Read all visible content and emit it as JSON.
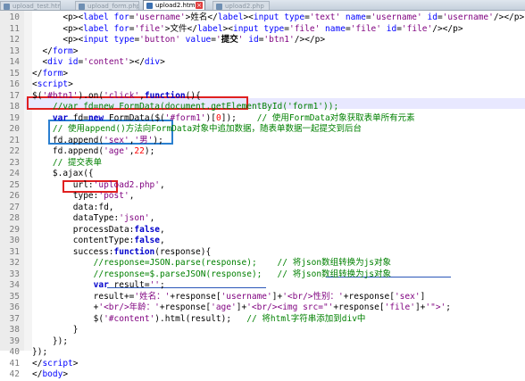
{
  "tabs": [
    {
      "label": "upload_test.html"
    },
    {
      "label": "upload_form.php"
    },
    {
      "label": "upload2.html"
    },
    {
      "label": "upload2.php"
    }
  ],
  "editor": {
    "lines": [
      {
        "no": "10",
        "html": "      &lt;p&gt;&lt;<span class='tag'>label</span> <span class='tag'>for</span>=<span class='str'>'username'</span>&gt;姓名&lt;/<span class='tag'>label</span>&gt;&lt;<span class='tag'>input</span> <span class='tag'>type</span>=<span class='str'>'text'</span> <span class='tag'>name</span>=<span class='str'>'username'</span> <span class='tag'>id</span>=<span class='str'>'username'</span>/&gt;&lt;/p&gt;"
      },
      {
        "no": "11",
        "html": "      &lt;p&gt;&lt;<span class='tag'>label</span> <span class='tag'>for</span>=<span class='str'>'file'</span>&gt;文件&lt;/<span class='tag'>label</span>&gt;&lt;<span class='tag'>input</span> <span class='tag'>type</span>=<span class='str'>'file'</span> <span class='tag'>name</span>=<span class='str'>'file'</span> <span class='tag'>id</span>=<span class='str'>'file'</span>/&gt;&lt;/p&gt;"
      },
      {
        "no": "12",
        "html": "      &lt;p&gt;&lt;<span class='tag'>input</span> <span class='tag'>type</span>=<span class='str'>'button'</span> <span class='tag'>value</span>=<span class='str'>'</span><b>提交</b><span class='str'>'</span> <span class='tag'>id</span>=<span class='str'>'btn1'</span>/&gt;&lt;/p&gt;"
      },
      {
        "no": "13",
        "html": "  &lt;/<span class='tag'>form</span>&gt;"
      },
      {
        "no": "14",
        "html": "  &lt;<span class='tag'>div</span> <span class='tag'>id</span>=<span class='str'>'content'</span>&gt;&lt;/<span class='tag'>div</span>&gt;"
      },
      {
        "no": "15",
        "html": "&lt;/<span class='tag'>form</span>&gt;"
      },
      {
        "no": "16",
        "html": "&lt;<span class='tag'>script</span>&gt;"
      },
      {
        "no": "17",
        "html": "$(<span class='str'>'#btn1'</span>).on(<span class='str'>'click'</span>,<span class='kw'>function</span>(){"
      },
      {
        "no": "18",
        "html": "    <span class='cm'>//var fd=new FormData(document.getElementById('form1'));</span>"
      },
      {
        "no": "19",
        "html": "    <span class='kw'>var</span> fd=<span class='kw'>new</span> FormData($(<span class='str'>'#form1'</span>)[<span class='num'>0</span>]);    <span class='cm'>// 使用FormData对象获取表单所有元素</span>"
      },
      {
        "no": "20",
        "html": "    <span class='cm'>// 使用append()方法向FormData对象中追加数据，随表单数据一起提交到后台</span>"
      },
      {
        "no": "21",
        "html": "    fd.append(<span class='str'>'sex'</span>,<span class='str'>'男'</span>);"
      },
      {
        "no": "22",
        "html": "    fd.append(<span class='str'>'age'</span>,<span class='num'>22</span>);"
      },
      {
        "no": "23",
        "html": "    <span class='cm'>// 提交表单</span>"
      },
      {
        "no": "24",
        "html": "    $.ajax({"
      },
      {
        "no": "25",
        "html": "        url:<span class='str'>'upload2.php'</span>,"
      },
      {
        "no": "26",
        "html": "        type:<span class='str'>'post'</span>,"
      },
      {
        "no": "27",
        "html": "        data:fd,"
      },
      {
        "no": "28",
        "html": "        dataType:<span class='str'>'json'</span>,"
      },
      {
        "no": "29",
        "html": "        processData:<span class='kw'>false</span>,"
      },
      {
        "no": "30",
        "html": "        contentType:<span class='kw'>false</span>,"
      },
      {
        "no": "31",
        "html": "        success:<span class='kw'>function</span>(response){"
      },
      {
        "no": "32",
        "html": "            <span class='cm'>//response=JSON.parse(response);    // 将json数组转换为js对象</span>"
      },
      {
        "no": "33",
        "html": "            <span class='cm'>//response=$.parseJSON(response);   // 将json数组转换为js对象</span>"
      },
      {
        "no": "34",
        "html": "            <span class='kw'>var</span> result=<span class='str'>''</span>;"
      },
      {
        "no": "35",
        "html": "            result+=<span class='str'>'姓名：'</span>+response[<span class='str'>'username'</span>]+<span class='str'>'&lt;br/&gt;性别：'</span>+response[<span class='str'>'sex'</span>]"
      },
      {
        "no": "36",
        "html": "            +<span class='str'>'&lt;br/&gt;年龄：'</span>+response[<span class='str'>'age'</span>]+<span class='str'>'&lt;br/&gt;&lt;img src=\"'</span>+response[<span class='str'>'file'</span>]+<span class='str'>'\"&gt;'</span>;"
      },
      {
        "no": "37",
        "html": "            $(<span class='str'>'#content'</span>).html(result);   <span class='cm'>// 将html字符串添加到div中</span>"
      },
      {
        "no": "38",
        "html": "        }"
      },
      {
        "no": "39",
        "html": "    });"
      },
      {
        "no": "40",
        "html": "});"
      },
      {
        "no": "41",
        "html": "&lt;/<span class='tag'>script</span>&gt;"
      },
      {
        "no": "42",
        "html": "&lt;/<span class='tag'>body</span>&gt;"
      }
    ],
    "current_line": "18"
  },
  "colors": {
    "red_box": "#e02020",
    "blue_box": "#2a7fd0",
    "underline": "#2a56b8"
  }
}
